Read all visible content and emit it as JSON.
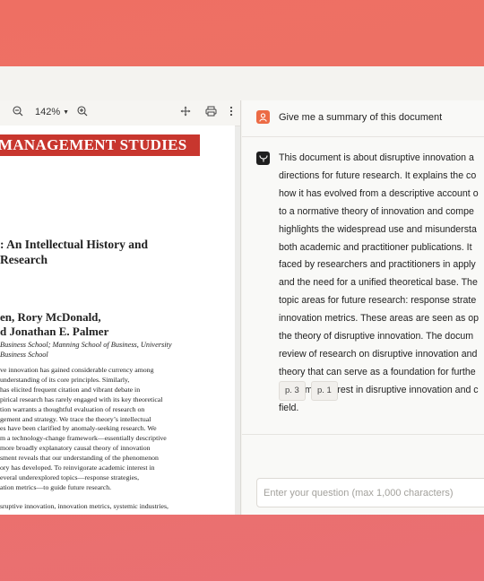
{
  "viewer": {
    "zoom": "142%",
    "icons": {
      "zoom_out": "zoom-out-icon",
      "zoom_in": "zoom-in-icon",
      "move": "move-icon",
      "print": "print-icon",
      "more": "more-vertical-icon"
    },
    "page": {
      "journal_banner": "MANAGEMENT STUDIES",
      "title_lines": ": An Intellectual History and",
      "title_line2": "Research",
      "authors_line1": "en, Rory McDonald,",
      "authors_line2": "d Jonathan E. Palmer",
      "affiliation_line1": " Business School; Manning School of Business, University",
      "affiliation_line2": "Business School",
      "abstract_lines": [
        "ve innovation has gained considerable currency among",
        "understanding of its core principles. Similarly,",
        " has elicited frequent citation and vibrant debate in",
        "pirical research has rarely engaged with its key theoretical",
        "tion warrants a thoughtful evaluation of research on",
        "gement and strategy. We trace the theory’s intellectual",
        "es have been clarified by anomaly-seeking research. We",
        "m a technology-change framework—essentially descriptive",
        " more broadly explanatory causal theory of innovation",
        "sment reveals that our understanding of the phenomenon",
        "ory has developed. To reinvigorate academic interest in",
        "everal underexplored topics—response strategies,",
        "ation metrics—to guide future research."
      ],
      "keywords": "sruptive innovation, innovation metrics, systemic industries,"
    }
  },
  "chat": {
    "user_icon": "user-icon",
    "assistant_icon": "assistant-logo-icon",
    "question": "Give me a summary of this document",
    "answer_lines": [
      "This document is about disruptive innovation a",
      "directions for future research. It explains the co",
      "how it has evolved from a descriptive account o",
      "to a normative theory of innovation and compe",
      "highlights the widespread use and misundersta",
      "both academic and practitioner publications. It",
      "faced by researchers and practitioners in apply",
      "and the need for a unified theoretical base. The",
      "topic areas for future research: response strate",
      "innovation metrics. These areas are seen as op",
      "the theory of disruptive innovation. The docum",
      "review of research on disruptive innovation and",
      "theory that can serve as a foundation for furthe",
      "academic interest in disruptive innovation and c",
      "field."
    ],
    "citations": [
      "p. 3",
      "p. 1"
    ],
    "input_placeholder": "Enter your question (max 1,000 characters)"
  }
}
